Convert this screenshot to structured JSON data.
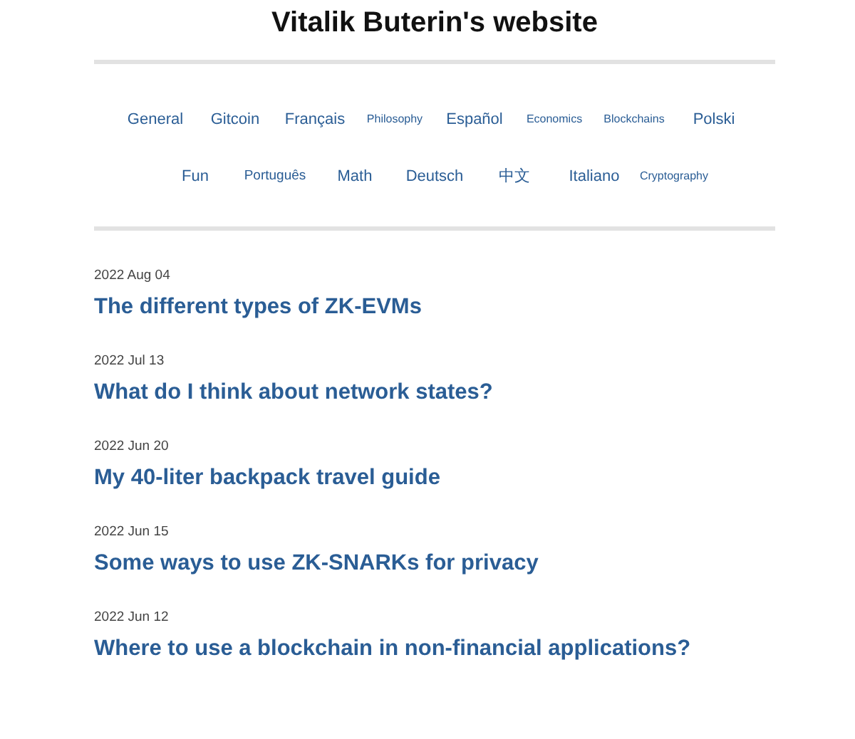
{
  "site_title": "Vitalik Buterin's website",
  "tags": [
    {
      "label": "General",
      "kind": "large"
    },
    {
      "label": "Gitcoin",
      "kind": "large"
    },
    {
      "label": "Français",
      "kind": "large"
    },
    {
      "label": "Philosophy",
      "kind": "small"
    },
    {
      "label": "Español",
      "kind": "large"
    },
    {
      "label": "Economics",
      "kind": "small"
    },
    {
      "label": "Blockchains",
      "kind": "small"
    },
    {
      "label": "Polski",
      "kind": "large"
    },
    {
      "label": "Fun",
      "kind": "large"
    },
    {
      "label": "Português",
      "kind": "medium"
    },
    {
      "label": "Math",
      "kind": "large"
    },
    {
      "label": "Deutsch",
      "kind": "large"
    },
    {
      "label": "中文",
      "kind": "large"
    },
    {
      "label": "Italiano",
      "kind": "large"
    },
    {
      "label": "Cryptography",
      "kind": "small"
    }
  ],
  "posts": [
    {
      "date": "2022 Aug 04",
      "title": "The different types of ZK-EVMs"
    },
    {
      "date": "2022 Jul 13",
      "title": "What do I think about network states?"
    },
    {
      "date": "2022 Jun 20",
      "title": "My 40-liter backpack travel guide"
    },
    {
      "date": "2022 Jun 15",
      "title": "Some ways to use ZK-SNARKs for privacy"
    },
    {
      "date": "2022 Jun 12",
      "title": "Where to use a blockchain in non-financial applications?"
    }
  ]
}
